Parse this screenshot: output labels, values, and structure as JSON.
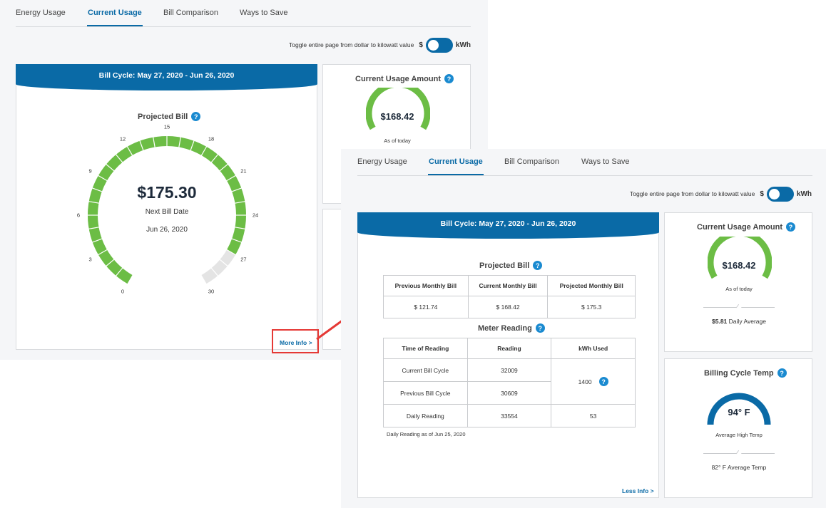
{
  "tabs": [
    "Energy Usage",
    "Current Usage",
    "Bill Comparison",
    "Ways to Save"
  ],
  "active_tab": "Current Usage",
  "toggle": {
    "label": "Toggle entire page from dollar to kilowatt value",
    "left": "$",
    "right": "kWh"
  },
  "bill_cycle": "Bill Cycle: May 27, 2020 - Jun 26, 2020",
  "projected_bill": {
    "title": "Projected Bill",
    "amount": "$175.30",
    "next_bill_label": "Next Bill Date",
    "next_bill_date": "Jun 26, 2020",
    "ticks": [
      "0",
      "3",
      "6",
      "9",
      "12",
      "15",
      "18",
      "21",
      "24",
      "27",
      "30"
    ],
    "progress_days": 27,
    "total_days": 30
  },
  "current_usage": {
    "title": "Current Usage Amount",
    "amount": "$168.42",
    "sub": "As of today",
    "daily_value": "$5.81",
    "daily_label": "Daily Average"
  },
  "billing_temp": {
    "title": "Billing Cycle Temp",
    "value": "94° F",
    "sub": "Average High Temp",
    "avg_value": "82° F",
    "avg_label": "Average Temp"
  },
  "links": {
    "more_info": "More Info >",
    "less_info": "Less Info >"
  },
  "bill_table": {
    "headers": [
      "Previous Monthly Bill",
      "Current Monthly Bill",
      "Projected Monthly Bill"
    ],
    "values": [
      "$ 121.74",
      "$ 168.42",
      "$ 175.3"
    ]
  },
  "meter": {
    "title": "Meter Reading",
    "headers": [
      "Time of Reading",
      "Reading",
      "kWh Used"
    ],
    "rows": [
      {
        "label": "Current Bill Cycle",
        "reading": "32009"
      },
      {
        "label": "Previous Bill Cycle",
        "reading": "30609"
      },
      {
        "label": "Daily Reading",
        "reading": "33554"
      }
    ],
    "kwh_cycle": "1400",
    "kwh_daily": "53",
    "note": "Daily Reading as of Jun 25, 2020"
  },
  "help_glyph": "?",
  "colors": {
    "brand_blue": "#0a6aa6",
    "gauge_green": "#6cbd45",
    "gauge_gray": "#e4e4e4",
    "temp_blue": "#0a6aa6",
    "highlight_red": "#e53935"
  }
}
